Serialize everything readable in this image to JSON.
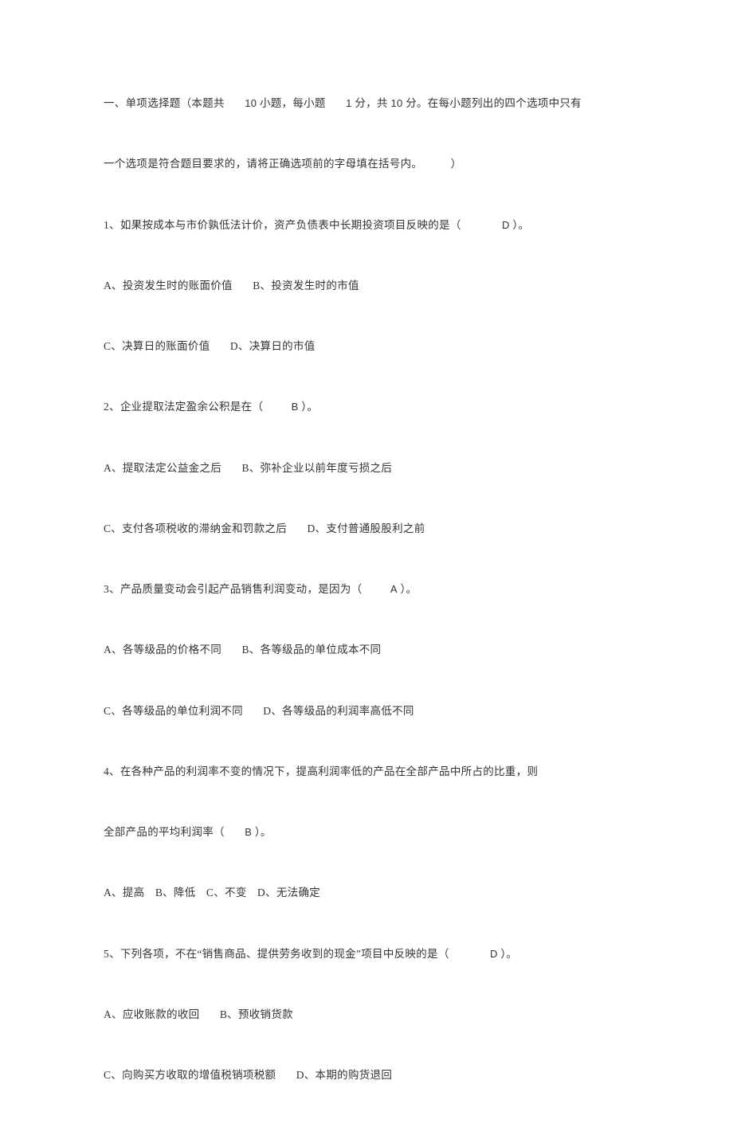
{
  "header": {
    "part1": "一、单项选择题（本题共",
    "count_questions": "10",
    "part2": "小题，每小题",
    "points_each": "1",
    "part3": "分，共",
    "total_points": "10",
    "part4": "分。在每小题列出的四个选项中只有",
    "line2": "一个选项是符合题目要求的，请将正确选项前的字母填在括号内。",
    "paren": "）"
  },
  "q1": {
    "stem_a": "1、如果按成本与市价孰低法计价，资产负债表中长期投资项目反映的是（",
    "answer": "D",
    "stem_b": "）。",
    "optA": "A、投资发生时的账面价值",
    "optB": "B、投资发生时的市值",
    "optC": "C、决算日的账面价值",
    "optD": "D、决算日的市值"
  },
  "q2": {
    "stem_a": "2、企业提取法定盈余公积是在（",
    "answer": "B",
    "stem_b": "）。",
    "optA": "A、提取法定公益金之后",
    "optB": "B、弥补企业以前年度亏损之后",
    "optC": "C、支付各项税收的滞纳金和罚款之后",
    "optD": "D、支付普通股股利之前"
  },
  "q3": {
    "stem_a": "3、产品质量变动会引起产品销售利润变动，是因为（",
    "answer": "A",
    "stem_b": "）。",
    "optA": "A、各等级品的价格不同",
    "optB": "B、各等级品的单位成本不同",
    "optC": "C、各等级品的单位利润不同",
    "optD": "D、各等级品的利润率高低不同"
  },
  "q4": {
    "stem_line1": "4、在各种产品的利润率不变的情况下，提高利润率低的产品在全部产品中所占的比重，则",
    "stem_a": "全部产品的平均利润率（",
    "answer": "B",
    "stem_b": "）。",
    "optA": "A、提高",
    "optB": "B、降低",
    "optC": "C、不变",
    "optD": "D、无法确定"
  },
  "q5": {
    "stem_a": "5、下列各项，不在“销售商品、提供劳务收到的现金”项目中反映的是（",
    "answer": "D",
    "stem_b": "）。",
    "optA": "A、应收账款的收回",
    "optB": "B、预收销货款",
    "optC": "C、向购买方收取的增值税销项税额",
    "optD": "D、本期的购货退回"
  }
}
